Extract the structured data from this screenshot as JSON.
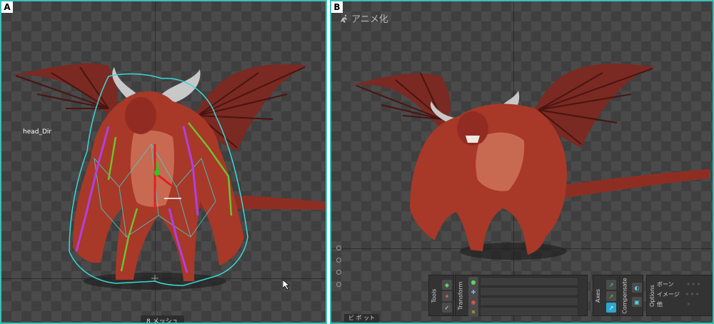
{
  "panel_a": {
    "label": "A",
    "bone_label": "head_Dir",
    "mesh_count": "8 メッシュ"
  },
  "panel_b": {
    "label": "B",
    "mode_title": "アニメ化",
    "toolbar": {
      "tools": "Tools",
      "transform": "Transform",
      "axes": "Axes",
      "compensate": "Compensate",
      "options": "Options",
      "option_rows": [
        "ボーン",
        "イメージ",
        "他"
      ]
    },
    "bottom_tab": "ビ ポ ット"
  },
  "colors": {
    "panel_border": "#38c0b8",
    "mesh_cyan": "#38d8d8",
    "bone_purple": "#b040e0",
    "bone_green": "#70c030",
    "creature_red": "#a83828"
  }
}
